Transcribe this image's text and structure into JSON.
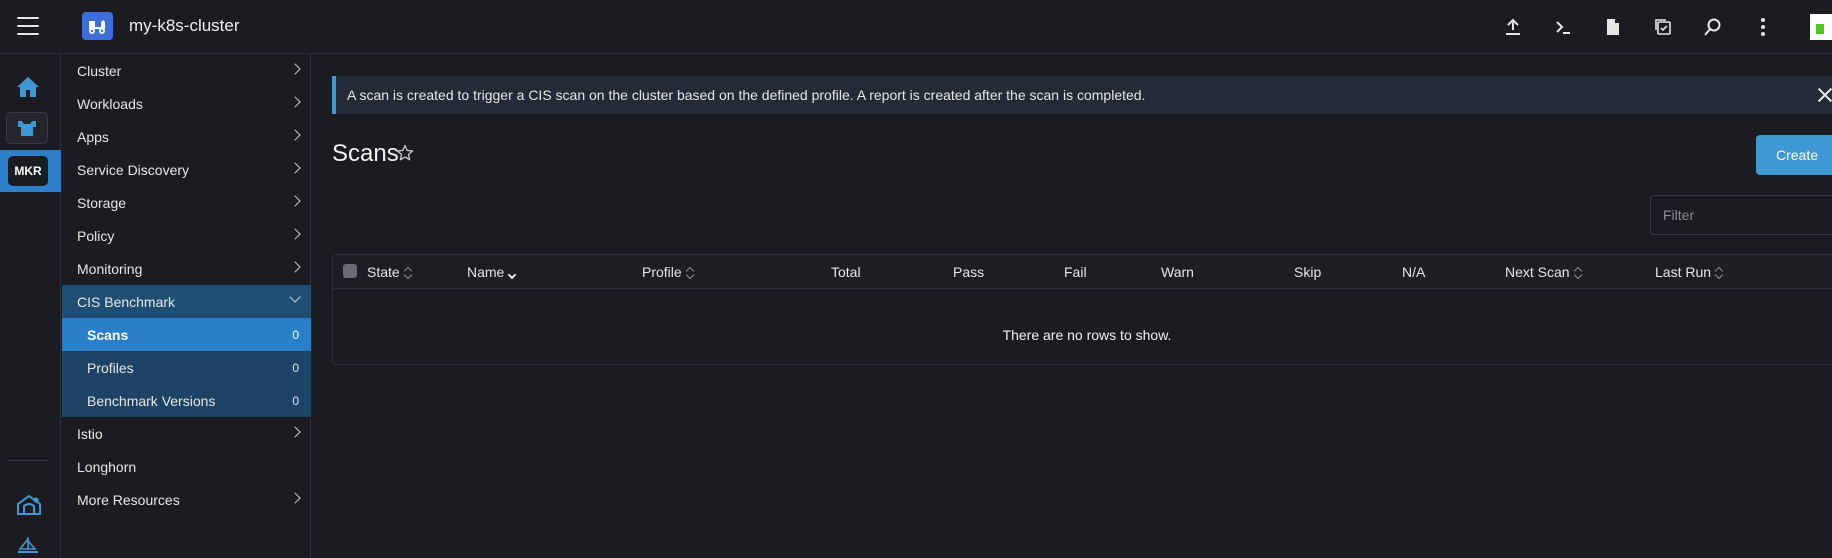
{
  "header": {
    "cluster_name": "my-k8s-cluster",
    "icons": [
      "upload-icon",
      "terminal-icon",
      "document-icon",
      "copy-config-icon",
      "search-icon",
      "more-vertical-icon"
    ]
  },
  "rail": {
    "cluster_badge": "MKR"
  },
  "sidebar": {
    "items": [
      {
        "label": "Cluster"
      },
      {
        "label": "Workloads"
      },
      {
        "label": "Apps"
      },
      {
        "label": "Service Discovery"
      },
      {
        "label": "Storage"
      },
      {
        "label": "Policy"
      },
      {
        "label": "Monitoring"
      },
      {
        "label": "CIS Benchmark"
      },
      {
        "label": "Istio"
      },
      {
        "label": "Longhorn"
      },
      {
        "label": "More Resources"
      }
    ],
    "cis_children": [
      {
        "label": "Scans",
        "count": "0"
      },
      {
        "label": "Profiles",
        "count": "0"
      },
      {
        "label": "Benchmark Versions",
        "count": "0"
      }
    ]
  },
  "banner": {
    "text": "A scan is created to trigger a CIS scan on the cluster based on the defined profile. A report is created after the scan is completed."
  },
  "page": {
    "title": "Scans",
    "create_label": "Create",
    "filter_placeholder": "Filter"
  },
  "table": {
    "columns": [
      "State",
      "Name",
      "Profile",
      "Total",
      "Pass",
      "Fail",
      "Warn",
      "Skip",
      "N/A",
      "Next Scan",
      "Last Run"
    ],
    "empty_text": "There are no rows to show.",
    "sorted_column": "Name"
  },
  "colors": {
    "accent": "#3d98d3",
    "active_nav": "#2a7fc9",
    "expanded_nav": "#1f4e75",
    "background": "#1b1c21"
  }
}
